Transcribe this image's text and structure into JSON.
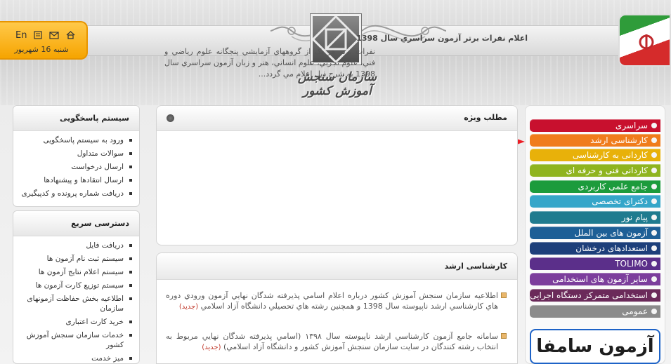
{
  "header": {
    "org_name": "سازمان سنجش آموزش کشور",
    "lang_label": "En",
    "date": "شنبه 16 شهریور"
  },
  "feature": {
    "title": "مطلب ويژه",
    "headline": "اعلام نفرات برتر آزمون سراسري سال 1398",
    "text": "نفرات برتر هر يک از گروههاي آزمايشي پنجگانه علوم رياضي و فني، علوم تجربي، علوم انساني، هنر و زبان آزمون سراسري سال 1398 به شرح ذيل اعلام مي گردد..."
  },
  "news": {
    "title": "کارشناسی ارشد",
    "items": [
      {
        "text": "اطلاعيه سازمان سنجش آموزش كشور درباره اعلام  اسامي پذيرفته شدگان نهايي آزمون ورودي دوره هاي كارشناسي ارشد ناپيوسته سال 1398 و همچنين رشته هاي تحصيلي دانشگاه آزاد اسلامي",
        "badge": "(جديد)"
      },
      {
        "text": "سامانه جامع آزمون كارشناسي ارشد ناپيوسته سال ۱۳۹۸ (اسامي پذيرفته شدگان نهايي مربوط به انتخاب رشته كنندگان در سايت سازمان سنجش آموزش كشور و دانشگاه آزاد اسلامي)",
        "badge": "(جديد)"
      }
    ]
  },
  "sidebar": {
    "response_title": "سیستم پاسخگویی",
    "response_items": [
      "ورود به سیستم پاسخگویی",
      "سوالات متداول",
      "ارسال درخواست",
      "ارسال انتقادها و پیشنهادها",
      "دریافت شماره پرونده و کدپیگیری"
    ],
    "quick_title": "دسترسی سریع",
    "quick_items": [
      "دریافت فایل",
      "سیستم ثبت نام آزمون ها",
      "سیستم اعلام نتایج آزمون ها",
      "سیستم توزیع کارت آزمون ها",
      "اطلاعیه بخش حفاظت آزمونهای سازمان",
      "خرید کارت اعتباری",
      "خدمات سازمان سنجش آموزش کشور",
      "میز خدمت"
    ]
  },
  "menu": {
    "items": [
      {
        "label": "سراسری",
        "color": "#c8102e"
      },
      {
        "label": "کارشناسی ارشد",
        "color": "#f07c1c"
      },
      {
        "label": "کاردانی به کارشناسی",
        "color": "#e8b10a"
      },
      {
        "label": "کاردانی فنی و حرفه ای",
        "color": "#8fb41f"
      },
      {
        "label": "جامع علمی کاربردی",
        "color": "#1c9b3c"
      },
      {
        "label": "دکترای تخصصی",
        "color": "#35a6c9"
      },
      {
        "label": "پیام نور",
        "color": "#1f7b8f"
      },
      {
        "label": "آزمون های بین الملل",
        "color": "#1d5f96"
      },
      {
        "label": "استعدادهای درخشان",
        "color": "#1d3f7a"
      },
      {
        "label": "TOLIMO",
        "color": "#5b2f8a"
      },
      {
        "label": "سایر آزمون های استخدامی",
        "color": "#7c3e9c"
      },
      {
        "label": "استخدامی متمرکز دستگاه اجرایی",
        "color": "#6b2a5a"
      },
      {
        "label": "عمومی",
        "color": "#8b8b8b"
      }
    ],
    "banner_text": "آزمون سامفا"
  }
}
